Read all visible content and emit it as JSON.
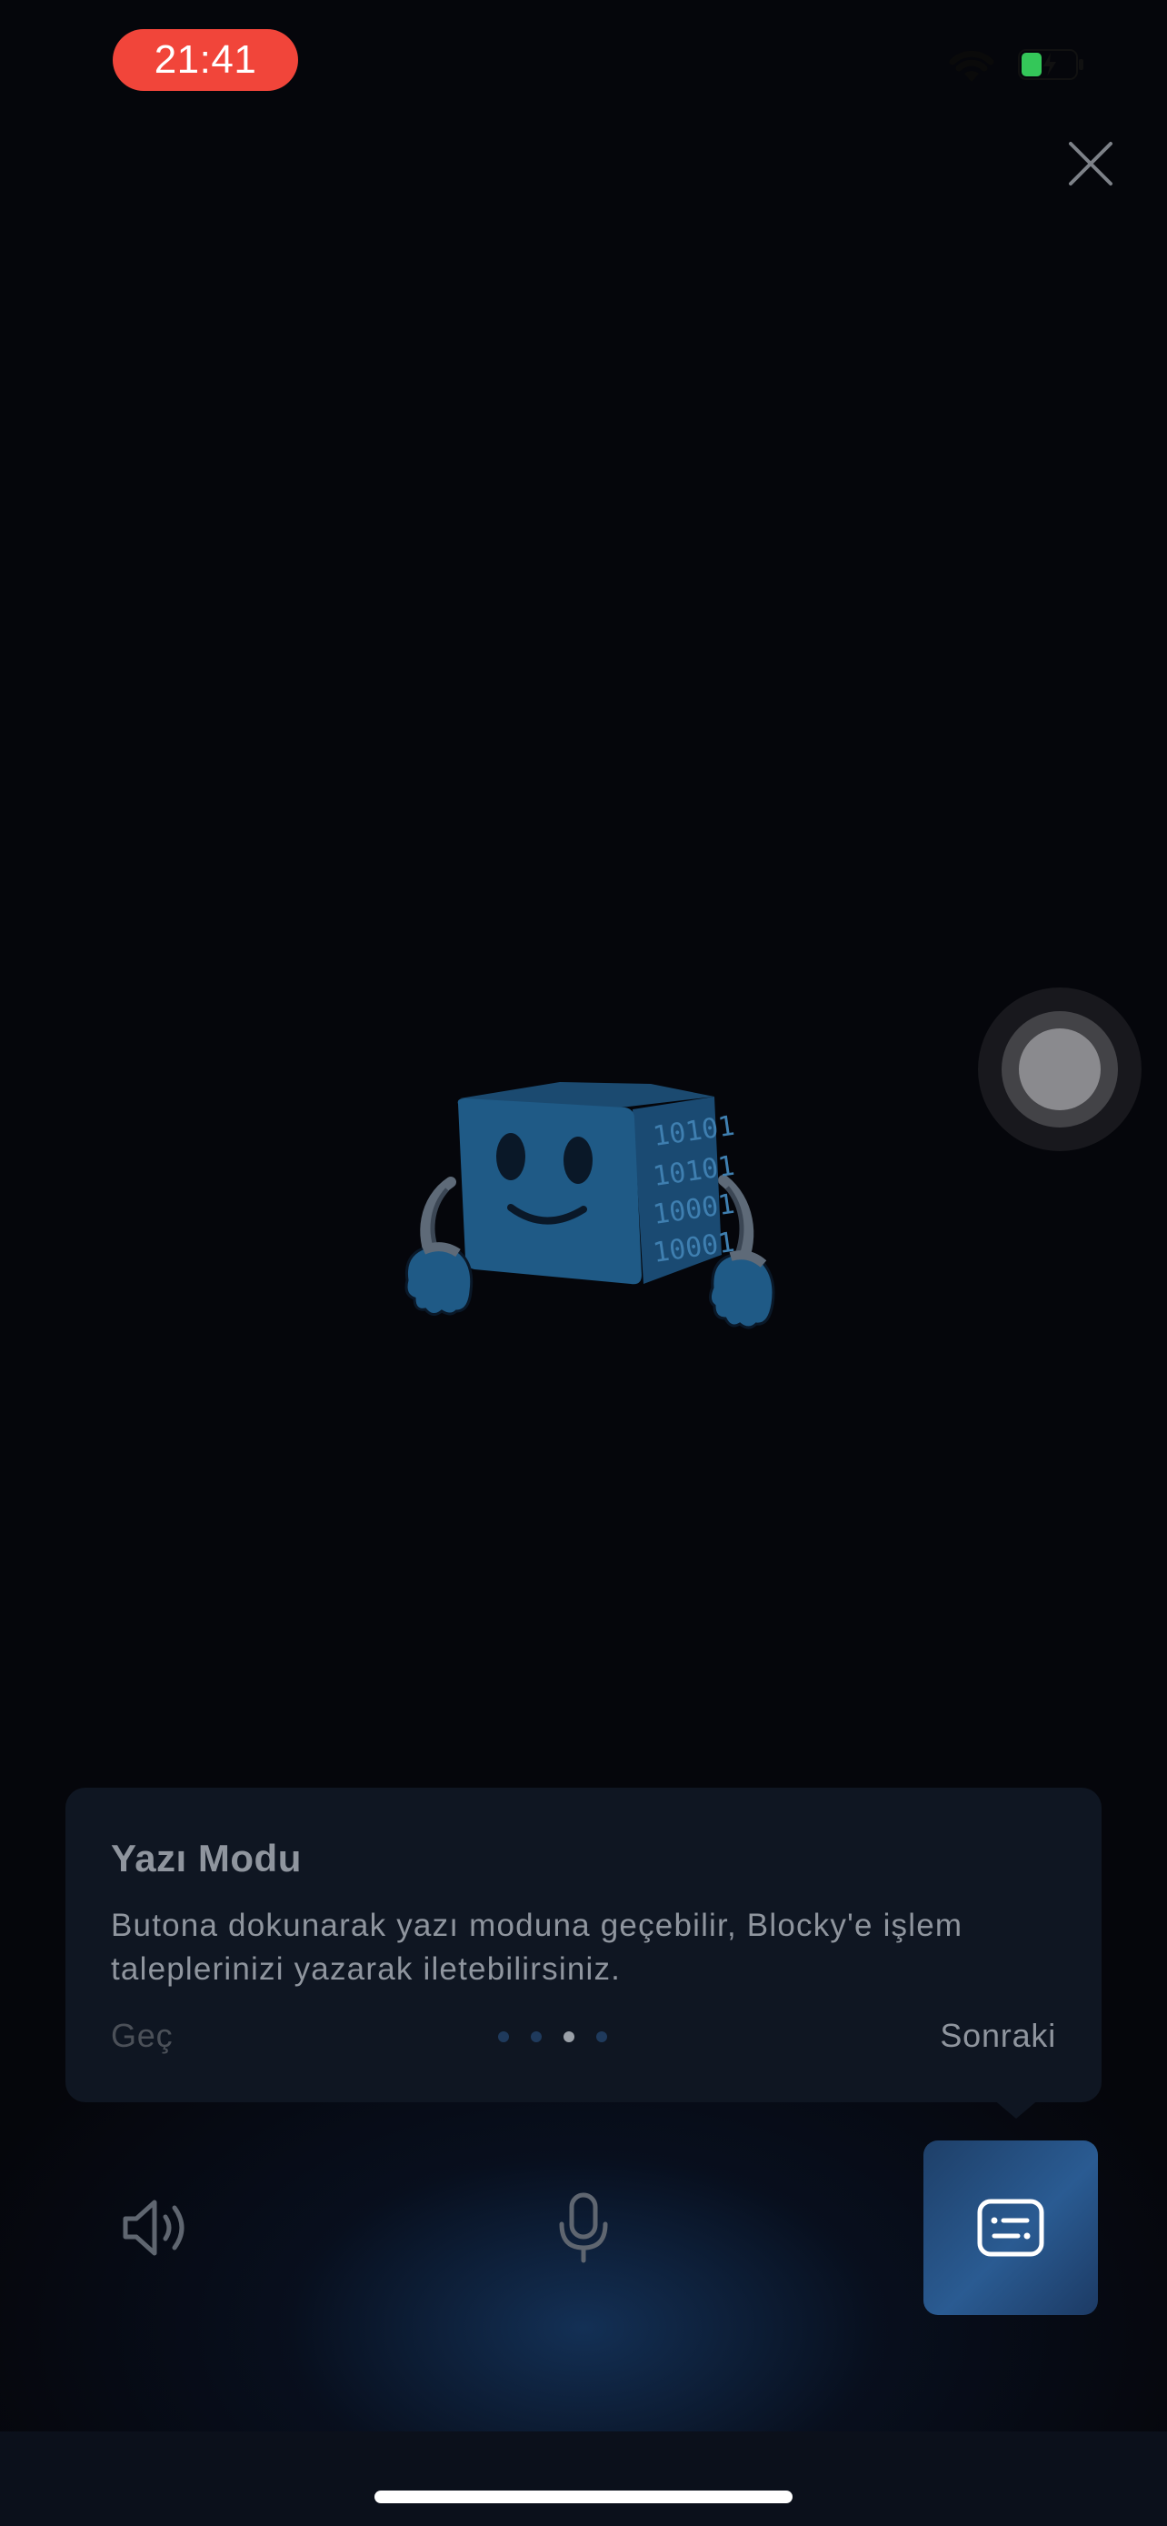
{
  "status_bar": {
    "time": "21:41"
  },
  "icons": {
    "close": "close-icon",
    "wifi": "wifi-icon",
    "battery": "battery-charging-icon",
    "speaker": "speaker-icon",
    "mic": "microphone-icon",
    "keyboard": "keyboard-icon",
    "mascot": "blocky-mascot"
  },
  "tooltip": {
    "title": "Yazı Modu",
    "body": "Butona dokunarak yazı moduna geçebilir, Blocky'e işlem taleplerinizi yazarak iletebilirsiniz.",
    "skip_label": "Geç",
    "next_label": "Sonraki",
    "pages_total": 4,
    "current_page": 3
  },
  "colors": {
    "background": "#05060b",
    "time_pill": "#f1453a",
    "card": "#0f1622",
    "accent": "#2a5b92",
    "battery_green": "#34c759",
    "mascot_blue": "#1f5a86"
  }
}
